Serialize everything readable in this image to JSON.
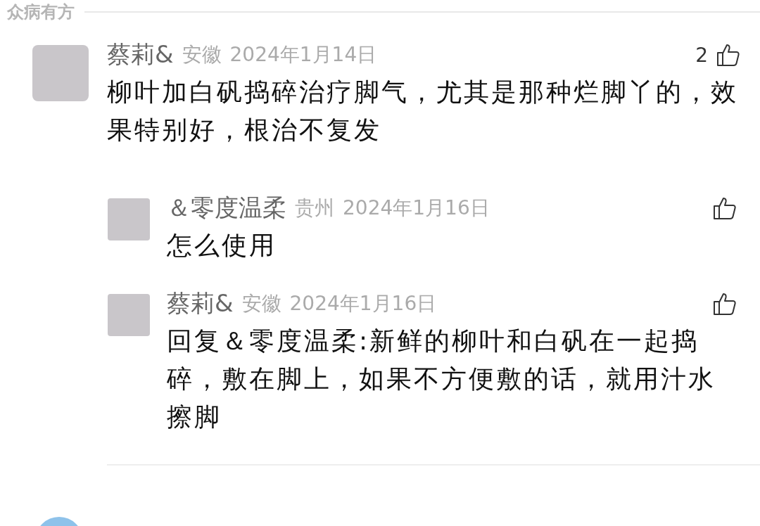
{
  "section_title": "众病有方",
  "comments": [
    {
      "author": "蔡莉&",
      "location": "安徽",
      "date": "2024年1月14日",
      "likes": "2",
      "text": "柳叶加白矾捣碎治疗脚气，尤其是那种烂脚丫的，效果特别好，根治不复发",
      "replies": [
        {
          "author": "＆零度温柔",
          "location": "贵州",
          "date": "2024年1月16日",
          "text": "怎么使用"
        },
        {
          "author": "蔡莉&",
          "location": "安徽",
          "date": "2024年1月16日",
          "text": "回复＆零度温柔:新鲜的柳叶和白矾在一起捣碎，敷在脚上，如果不方便敷的话，就用汁水擦脚"
        }
      ]
    }
  ]
}
